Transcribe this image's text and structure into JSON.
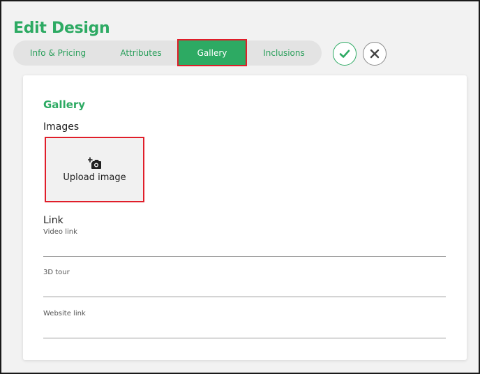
{
  "page": {
    "title": "Edit Design"
  },
  "tabs": [
    {
      "label": "Info & Pricing",
      "active": false
    },
    {
      "label": "Attributes",
      "active": false
    },
    {
      "label": "Gallery",
      "active": true
    },
    {
      "label": "Inclusions",
      "active": false
    }
  ],
  "actions": {
    "confirm_icon": "check-icon",
    "cancel_icon": "close-icon"
  },
  "gallery": {
    "section_title": "Gallery",
    "images_label": "Images",
    "upload_icon": "add-photo-icon",
    "upload_label": "Upload image"
  },
  "link": {
    "label": "Link",
    "fields": [
      {
        "label": "Video link",
        "value": ""
      },
      {
        "label": "3D tour",
        "value": ""
      },
      {
        "label": "Website link",
        "value": ""
      }
    ]
  },
  "colors": {
    "accent": "#2daa63",
    "highlight": "#e01e2a",
    "tab_bar": "#e3e3e3",
    "background": "#f2f2f2"
  }
}
